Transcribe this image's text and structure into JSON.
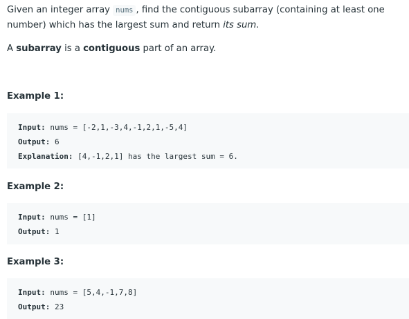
{
  "intro": {
    "part1": "Given an integer array ",
    "code": "nums",
    "part2": ", find the contiguous subarray (containing at least one number) which has the largest sum and return ",
    "emph": "its sum",
    "part3": "."
  },
  "definition": {
    "part1": "A ",
    "bold1": "subarray",
    "part2": " is a ",
    "bold2": "contiguous",
    "part3": " part of an array."
  },
  "examples": [
    {
      "title": "Example 1:",
      "input_label": "Input:",
      "input_value": " nums = [-2,1,-3,4,-1,2,1,-5,4]",
      "output_label": "Output:",
      "output_value": " 6",
      "explanation_label": "Explanation:",
      "explanation_value": " [4,-1,2,1] has the largest sum = 6."
    },
    {
      "title": "Example 2:",
      "input_label": "Input:",
      "input_value": " nums = [1]",
      "output_label": "Output:",
      "output_value": " 1"
    },
    {
      "title": "Example 3:",
      "input_label": "Input:",
      "input_value": " nums = [5,4,-1,7,8]",
      "output_label": "Output:",
      "output_value": " 23"
    }
  ]
}
